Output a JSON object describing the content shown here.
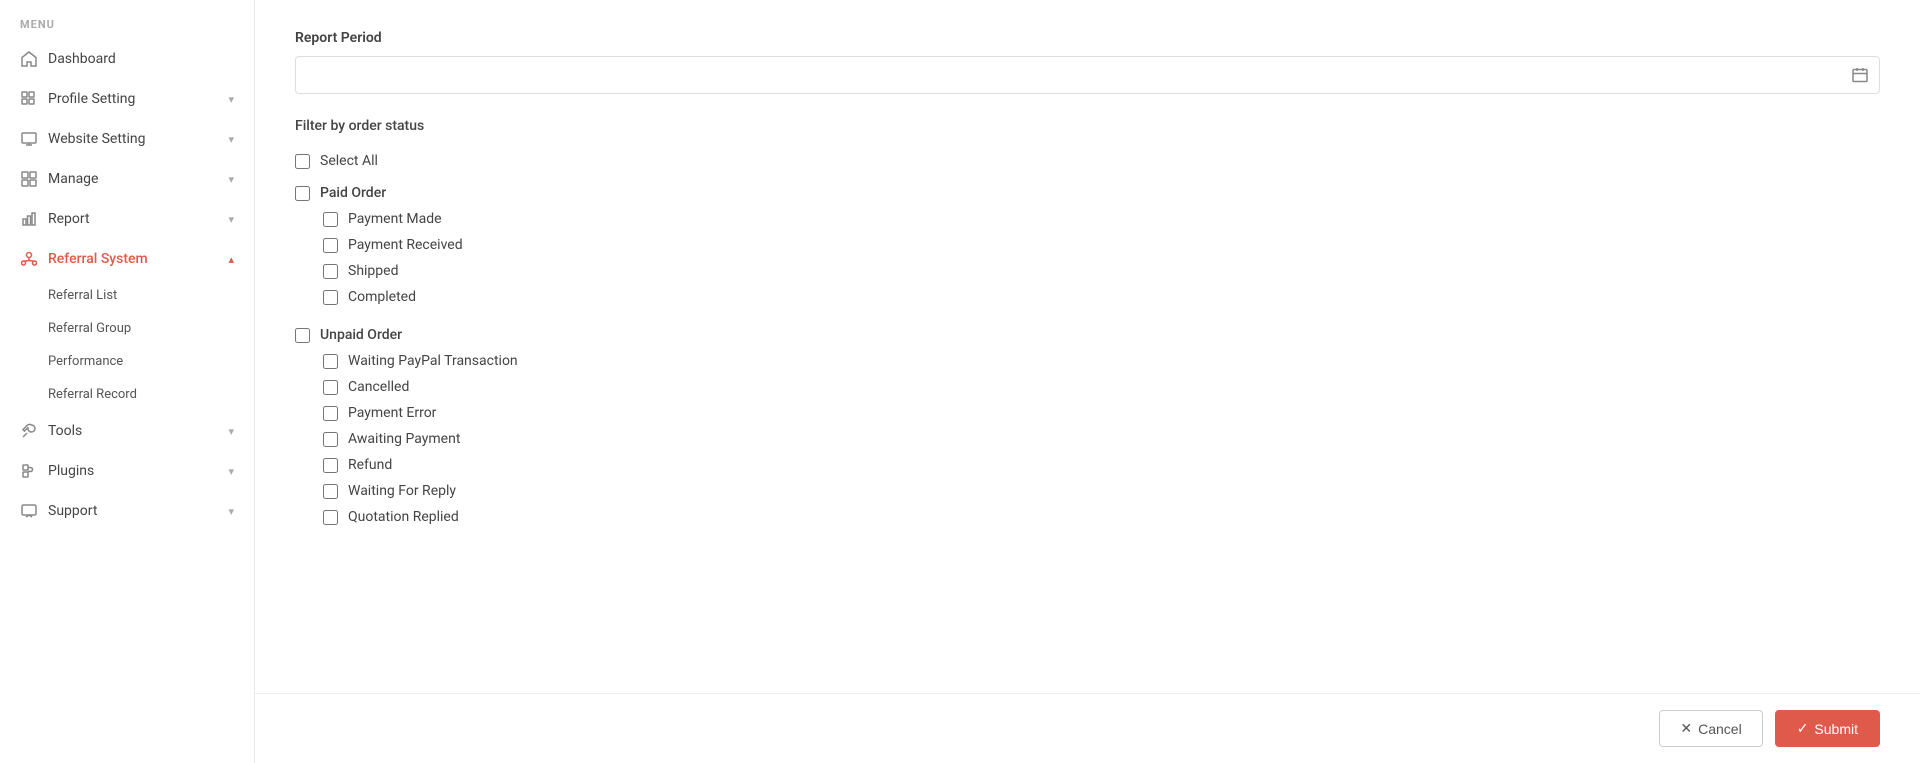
{
  "sidebar": {
    "menu_label": "MENU",
    "items": [
      {
        "id": "dashboard",
        "label": "Dashboard",
        "icon": "home",
        "active": false,
        "expandable": false
      },
      {
        "id": "profile-setting",
        "label": "Profile Setting",
        "icon": "profile",
        "active": false,
        "expandable": true
      },
      {
        "id": "website-setting",
        "label": "Website Setting",
        "icon": "monitor",
        "active": false,
        "expandable": true
      },
      {
        "id": "manage",
        "label": "Manage",
        "icon": "grid",
        "active": false,
        "expandable": true
      },
      {
        "id": "report",
        "label": "Report",
        "icon": "chart",
        "active": false,
        "expandable": true
      },
      {
        "id": "referral-system",
        "label": "Referral System",
        "icon": "referral",
        "active": true,
        "expandable": true
      }
    ],
    "subitems": [
      {
        "id": "referral-list",
        "label": "Referral List"
      },
      {
        "id": "referral-group",
        "label": "Referral Group"
      },
      {
        "id": "performance",
        "label": "Performance"
      },
      {
        "id": "referral-record",
        "label": "Referral Record"
      }
    ],
    "bottom_items": [
      {
        "id": "tools",
        "label": "Tools",
        "icon": "tools",
        "expandable": true
      },
      {
        "id": "plugins",
        "label": "Plugins",
        "icon": "plugin",
        "expandable": true
      },
      {
        "id": "support",
        "label": "Support",
        "icon": "support",
        "expandable": true
      }
    ]
  },
  "main": {
    "report_period_label": "Report Period",
    "date_input_placeholder": "",
    "filter_label": "Filter by order status",
    "select_all_label": "Select All",
    "paid_order_label": "Paid Order",
    "paid_order_subitems": [
      {
        "id": "payment-made",
        "label": "Payment Made"
      },
      {
        "id": "payment-received",
        "label": "Payment Received"
      },
      {
        "id": "shipped",
        "label": "Shipped"
      },
      {
        "id": "completed",
        "label": "Completed"
      }
    ],
    "unpaid_order_label": "Unpaid Order",
    "unpaid_order_subitems": [
      {
        "id": "waiting-paypal",
        "label": "Waiting PayPal Transaction"
      },
      {
        "id": "cancelled",
        "label": "Cancelled"
      },
      {
        "id": "payment-error",
        "label": "Payment Error"
      },
      {
        "id": "awaiting-payment",
        "label": "Awaiting Payment"
      },
      {
        "id": "refund",
        "label": "Refund"
      },
      {
        "id": "waiting-for-reply",
        "label": "Waiting For Reply"
      },
      {
        "id": "quotation-replied",
        "label": "Quotation Replied"
      }
    ],
    "cancel_button_label": "Cancel",
    "submit_button_label": "Submit"
  },
  "colors": {
    "accent": "#e05a4b",
    "sidebar_active": "#e05a4b"
  }
}
